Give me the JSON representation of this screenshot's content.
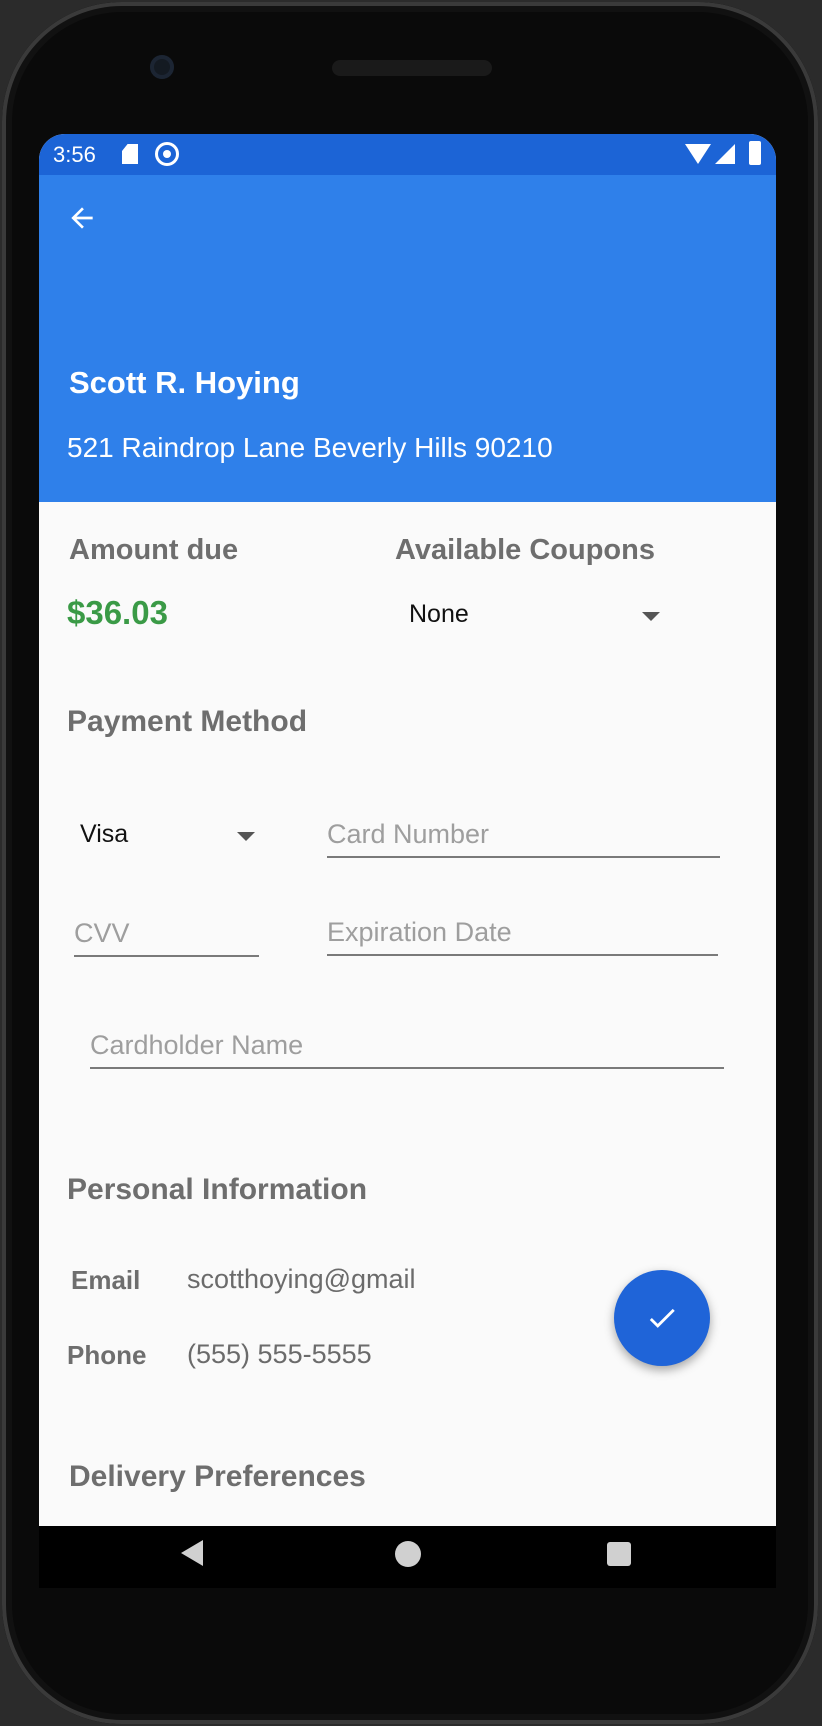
{
  "status_bar": {
    "time": "3:56"
  },
  "customer": {
    "name": "Scott R. Hoying",
    "address": "521 Raindrop Lane Beverly Hills 90210"
  },
  "billing": {
    "amount_due_label": "Amount due",
    "amount_due_value": "$36.03",
    "coupons_label": "Available Coupons",
    "coupons_selected": "None"
  },
  "payment": {
    "section_title": "Payment Method",
    "card_type_selected": "Visa",
    "card_number_placeholder": "Card Number",
    "cvv_placeholder": "CVV",
    "expiration_placeholder": "Expiration Date",
    "cardholder_placeholder": "Cardholder Name"
  },
  "personal": {
    "section_title": "Personal Information",
    "email_label": "Email",
    "email_value": "scotthoying@gmail",
    "phone_label": "Phone",
    "phone_value": "(555) 555-5555"
  },
  "delivery": {
    "section_title": "Delivery Preferences"
  },
  "colors": {
    "status_bar": "#1c64d6",
    "app_bar": "#2f80ea",
    "fab": "#1f64d8",
    "amount_green": "#3a9a46"
  },
  "icons": {
    "back": "arrow-left-icon",
    "fab": "check-icon"
  }
}
